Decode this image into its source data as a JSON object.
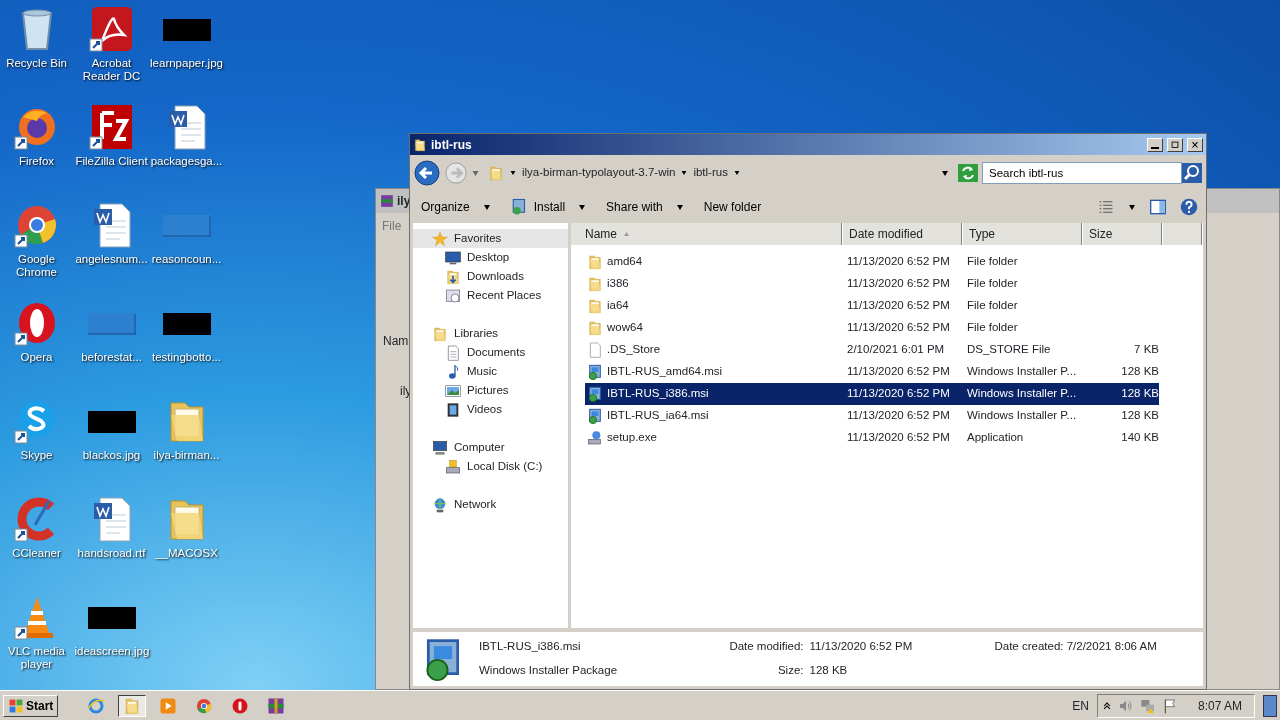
{
  "desktop_icons": [
    {
      "label": "Recycle Bin",
      "kind": "recycle"
    },
    {
      "label": "Firefox",
      "kind": "firefox"
    },
    {
      "label": "Google Chrome",
      "kind": "chrome"
    },
    {
      "label": "Opera",
      "kind": "opera"
    },
    {
      "label": "Skype",
      "kind": "skype"
    },
    {
      "label": "CCleaner",
      "kind": "ccleaner"
    },
    {
      "label": "VLC media player",
      "kind": "vlc"
    },
    {
      "label": "Acrobat Reader DC",
      "kind": "acrobat"
    },
    {
      "label": "FileZilla Client",
      "kind": "filezilla"
    },
    {
      "label": "angelesnum...",
      "kind": "word"
    },
    {
      "label": "beforestat...",
      "kind": "blank"
    },
    {
      "label": "blackos.jpg",
      "kind": "image"
    },
    {
      "label": "handsroad.rtf",
      "kind": "word"
    },
    {
      "label": "ideascreen.jpg",
      "kind": "image"
    },
    {
      "label": "learnpaper.jpg",
      "kind": "image"
    },
    {
      "label": "packagesga...",
      "kind": "word"
    },
    {
      "label": "reasoncoun...",
      "kind": "blank"
    },
    {
      "label": "testingbotto...",
      "kind": "image"
    },
    {
      "label": "ilya-birman...",
      "kind": "folder"
    },
    {
      "label": "__MACOSX",
      "kind": "folder"
    }
  ],
  "background_window": {
    "title": "ily",
    "menu": "File",
    "column": "Nam",
    "row": "ily"
  },
  "explorer": {
    "title": "ibtl-rus",
    "breadcrumb": [
      "ilya-birman-typolayout-3.7-win",
      "ibtl-rus"
    ],
    "search": {
      "placeholder": "Search ibtl-rus"
    },
    "toolbar": [
      {
        "label": "Organize",
        "dropdown": true,
        "kind": "plain"
      },
      {
        "label": "Install",
        "dropdown": true,
        "kind": "install"
      },
      {
        "label": "Share with",
        "dropdown": true,
        "kind": "plain"
      },
      {
        "label": "New folder",
        "dropdown": false,
        "kind": "plain"
      }
    ],
    "nav": [
      {
        "label": "Favorites",
        "kind": "star",
        "highlighted": true,
        "children": [
          {
            "label": "Desktop",
            "kind": "desktop"
          },
          {
            "label": "Downloads",
            "kind": "downloads"
          },
          {
            "label": "Recent Places",
            "kind": "recent"
          }
        ]
      },
      {
        "label": "Libraries",
        "kind": "library",
        "highlighted": false,
        "children": [
          {
            "label": "Documents",
            "kind": "documents"
          },
          {
            "label": "Music",
            "kind": "music"
          },
          {
            "label": "Pictures",
            "kind": "pictures"
          },
          {
            "label": "Videos",
            "kind": "videos"
          }
        ]
      },
      {
        "label": "Computer",
        "kind": "computer",
        "highlighted": false,
        "children": [
          {
            "label": "Local Disk (C:)",
            "kind": "disk"
          }
        ]
      },
      {
        "label": "Network",
        "kind": "network",
        "highlighted": false
      }
    ],
    "columns": [
      {
        "label": "Name",
        "sorted": true
      },
      {
        "label": "Date modified",
        "sorted": false
      },
      {
        "label": "Type",
        "sorted": false
      },
      {
        "label": "Size",
        "sorted": false
      }
    ],
    "files": [
      {
        "name": "amd64",
        "date": "11/13/2020 6:52 PM",
        "type": "File folder",
        "kind": "folder",
        "selected": false
      },
      {
        "name": "i386",
        "date": "11/13/2020 6:52 PM",
        "type": "File folder",
        "kind": "folder",
        "selected": false
      },
      {
        "name": "ia64",
        "date": "11/13/2020 6:52 PM",
        "type": "File folder",
        "kind": "folder",
        "selected": false
      },
      {
        "name": "wow64",
        "date": "11/13/2020 6:52 PM",
        "type": "File folder",
        "kind": "folder",
        "selected": false
      },
      {
        "name": ".DS_Store",
        "date": "2/10/2021 6:01 PM",
        "type": "DS_STORE File",
        "size": "7 KB",
        "kind": "file",
        "selected": false
      },
      {
        "name": "IBTL-RUS_amd64.msi",
        "date": "11/13/2020 6:52 PM",
        "type": "Windows Installer P...",
        "size": "128 KB",
        "kind": "msi",
        "selected": false
      },
      {
        "name": "IBTL-RUS_i386.msi",
        "date": "11/13/2020 6:52 PM",
        "type": "Windows Installer P...",
        "size": "128 KB",
        "kind": "msi",
        "selected": true
      },
      {
        "name": "IBTL-RUS_ia64.msi",
        "date": "11/13/2020 6:52 PM",
        "type": "Windows Installer P...",
        "size": "128 KB",
        "kind": "msi",
        "selected": false
      },
      {
        "name": "setup.exe",
        "date": "11/13/2020 6:52 PM",
        "type": "Application",
        "size": "140 KB",
        "kind": "exe",
        "selected": false
      }
    ],
    "details": {
      "name": "IBTL-RUS_i386.msi",
      "type": "Windows Installer Package",
      "fields": [
        {
          "label": "Date modified:",
          "value": "11/13/2020 6:52 PM"
        },
        {
          "label": "Size:",
          "value": "128 KB"
        },
        {
          "label": "Date created:",
          "value": "7/2/2021 8:06 AM"
        }
      ]
    }
  },
  "taskbar": {
    "start": "Start",
    "apps": [
      {
        "kind": "ie",
        "active": false
      },
      {
        "kind": "explorer",
        "active": true
      },
      {
        "kind": "media",
        "active": false
      },
      {
        "kind": "chrome",
        "active": false
      },
      {
        "kind": "opera",
        "active": false
      },
      {
        "kind": "winrar",
        "active": false
      }
    ],
    "language": "EN",
    "time": "8:07 AM"
  }
}
